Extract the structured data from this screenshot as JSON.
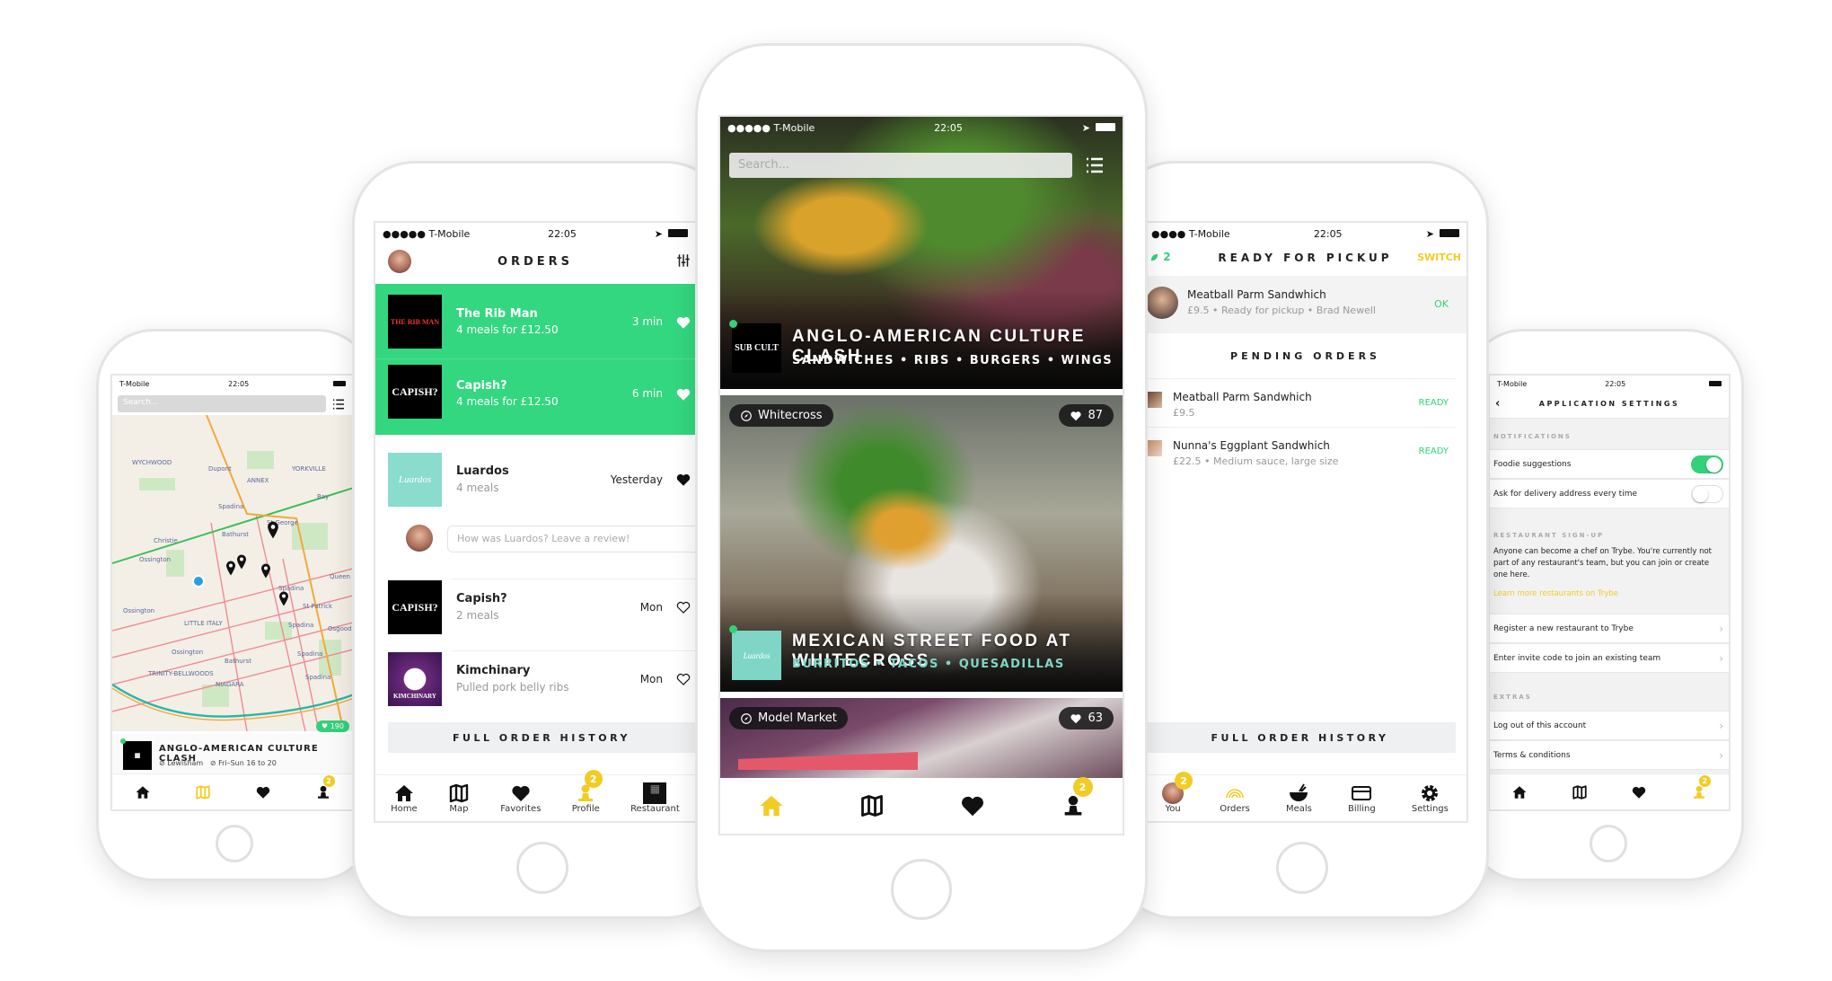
{
  "status_bar": {
    "carrier": "T-Mobile",
    "time": "22:05"
  },
  "colors": {
    "accent_green": "#33d17a",
    "accent_yellow": "#f2cc25",
    "teal_logo": "#7fd6c6"
  },
  "map_screen": {
    "search_placeholder": "Search...",
    "map_labels": [
      "WYCHWOOD",
      "Dupont",
      "ANNEX",
      "YORKVILLE",
      "Spadina",
      "Bay",
      "St George",
      "Bathurst",
      "Christie",
      "Ossington",
      "Queen",
      "Spadina",
      "St Patrick",
      "Ossington",
      "LITTLE ITALY",
      "Spadina",
      "Osgoode",
      "Ossington",
      "TRINITY-BELLWOODS",
      "Bathurst",
      "Spadina",
      "NIAGARA",
      "Spadina"
    ],
    "likes": "190",
    "card_title": "ANGLO-AMERICAN CULTURE CLASH",
    "card_location": "Lewisham",
    "card_hours": "Fri–Sun 16 to 20",
    "tabs": [
      {
        "icon": "home-icon"
      },
      {
        "icon": "map-icon",
        "active": true
      },
      {
        "icon": "heart-icon"
      },
      {
        "icon": "profile-icon",
        "badge": "2"
      }
    ]
  },
  "orders_screen": {
    "title": "ORDERS",
    "active_orders": [
      {
        "name": "The Rib Man",
        "detail": "4 meals for £12.50",
        "time": "3 min",
        "logo": "THE RIB MAN"
      },
      {
        "name": "Capish?",
        "detail": "4 meals for £12.50",
        "time": "6 min",
        "logo": "CAPISH?"
      }
    ],
    "past_orders": [
      {
        "name": "Luardos",
        "detail": "4 meals",
        "time": "Yesterday",
        "favorited": true,
        "logo": "Luardos"
      },
      {
        "name": "Capish?",
        "detail": "2 meals",
        "time": "Mon",
        "favorited": false,
        "logo": "CAPISH?"
      },
      {
        "name": "Kimchinary",
        "detail": "Pulled pork belly ribs",
        "time": "Mon",
        "favorited": false,
        "logo": "KIMCHINARY"
      }
    ],
    "review_placeholder": "How was Luardos? Leave a review!",
    "full_history": "FULL ORDER HISTORY",
    "tabs": [
      {
        "label": "Home"
      },
      {
        "label": "Map"
      },
      {
        "label": "Favorites"
      },
      {
        "label": "Profile",
        "badge": "2",
        "active": true
      },
      {
        "label": "Restaurant"
      }
    ]
  },
  "feed_screen": {
    "search_placeholder": "Search...",
    "cards": [
      {
        "title": "ANGLO-AMERICAN CULTURE CLASH",
        "tags": "SANDWICHES • RIBS • BURGERS • WINGS",
        "logo": "SUB CULT"
      },
      {
        "location": "Whitecross",
        "likes": "87",
        "title": "MEXICAN STREET FOOD AT WHITECROSS",
        "tags": "BURRITOS • TACOS • QUESADILLAS"
      },
      {
        "location": "Model Market",
        "likes": "63"
      }
    ],
    "tabs": [
      {
        "icon": "home-icon",
        "active": true
      },
      {
        "icon": "map-icon"
      },
      {
        "icon": "heart-icon"
      },
      {
        "icon": "profile-icon",
        "badge": "2"
      }
    ]
  },
  "pickup_screen": {
    "count": "2",
    "title": "READY FOR PICKUP",
    "switch": "SWITCH",
    "ready": {
      "name": "Meatball Parm Sandwhich",
      "detail": "£9.5 • Ready for pickup • Brad Newell",
      "action": "OK"
    },
    "pending_title": "PENDING ORDERS",
    "pending": [
      {
        "name": "Meatball Parm Sandwhich",
        "detail": "£9.5",
        "status": "READY"
      },
      {
        "name": "Nunna's Eggplant Sandwhich",
        "detail": "£22.5 • Medium sauce, large size",
        "status": "READY"
      }
    ],
    "full_history": "FULL ORDER HISTORY",
    "tabs": [
      {
        "label": "You",
        "badge": "2"
      },
      {
        "label": "Orders",
        "active": true
      },
      {
        "label": "Meals"
      },
      {
        "label": "Billing"
      },
      {
        "label": "Settings"
      }
    ]
  },
  "settings_screen": {
    "title": "APPLICATION SETTINGS",
    "notifications_header": "NOTIFICATIONS",
    "toggles": [
      {
        "label": "Foodie suggestions",
        "on": true
      },
      {
        "label": "Ask for delivery address every time",
        "on": false
      }
    ],
    "signup_header": "RESTAURANT SIGN-UP",
    "signup_text": "Anyone can become a chef on Trybe. You're currently not part of any restaurant's team, but you can join or create one here.",
    "signup_link": "Learn more restaurants on Trybe",
    "signup_rows": [
      "Register a new restaurant to Trybe",
      "Enter invite code to join an existing team"
    ],
    "extras_header": "EXTRAS",
    "extras_rows": [
      "Log out of this account",
      "Terms & conditions"
    ],
    "tabs": [
      {
        "icon": "home-icon"
      },
      {
        "icon": "map-icon"
      },
      {
        "icon": "heart-icon"
      },
      {
        "icon": "profile-icon",
        "badge": "2",
        "active": true
      }
    ]
  }
}
